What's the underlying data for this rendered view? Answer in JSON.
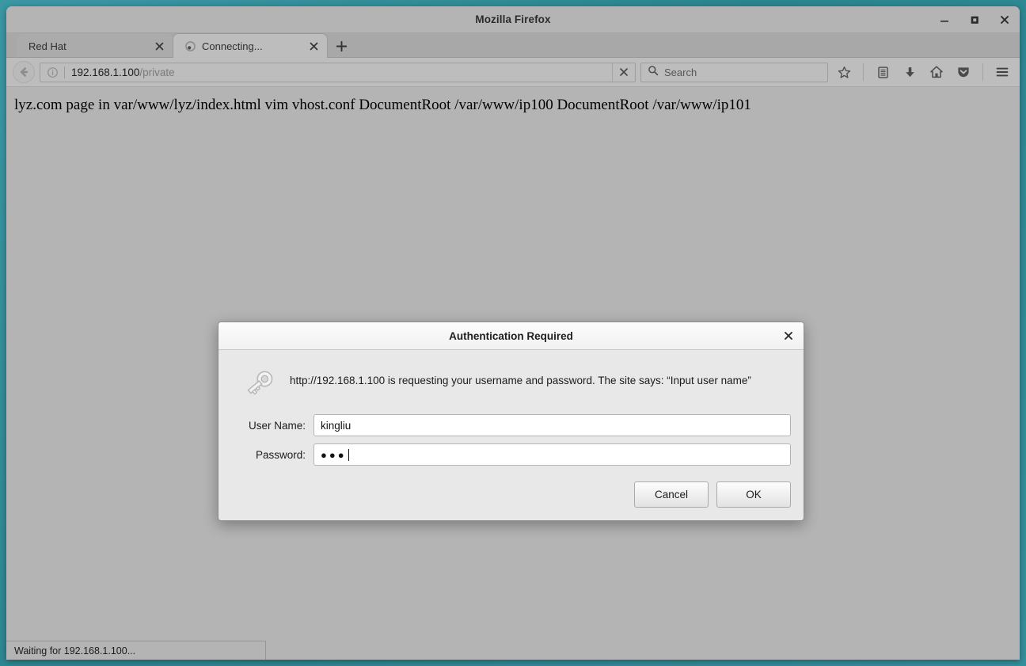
{
  "window": {
    "title": "Mozilla Firefox",
    "controls": [
      {
        "name": "minimize-button",
        "glyph": "minimize-icon"
      },
      {
        "name": "maximize-button",
        "glyph": "maximize-icon"
      },
      {
        "name": "close-button",
        "glyph": "close-icon"
      }
    ]
  },
  "tabs": [
    {
      "label": "Red Hat",
      "active": false,
      "loading": false
    },
    {
      "label": "Connecting...",
      "active": true,
      "loading": true
    }
  ],
  "newtab_label": "+",
  "toolbar": {
    "back_icon": "back-arrow-icon",
    "identity_icon": "info-icon",
    "url_host": "192.168.1.100",
    "url_path": "/private",
    "stop_icon": "stop-icon",
    "search": {
      "icon": "search-icon",
      "placeholder": "Search",
      "value": ""
    },
    "buttons": [
      {
        "name": "bookmark-star-button",
        "icon": "star-icon"
      },
      {
        "name": "library-button",
        "icon": "library-icon"
      },
      {
        "name": "downloads-button",
        "icon": "download-icon"
      },
      {
        "name": "home-button",
        "icon": "home-icon"
      },
      {
        "name": "pocket-button",
        "icon": "pocket-shield-icon"
      },
      {
        "name": "menu-button",
        "icon": "hamburger-menu-icon"
      }
    ]
  },
  "page": {
    "text": "lyz.com page in var/www/lyz/index.html vim vhost.conf DocumentRoot /var/www/ip100 DocumentRoot /var/www/ip101"
  },
  "status": {
    "text": "Waiting for 192.168.1.100..."
  },
  "dialog": {
    "title": "Authentication Required",
    "close_icon": "close-icon",
    "key_icon": "key-icon",
    "message": "http://192.168.1.100 is requesting your username and password. The site says: “Input user name”",
    "username": {
      "label": "User Name:",
      "value": "kingliu",
      "placeholder": ""
    },
    "password": {
      "label": "Password:",
      "value": "●●●",
      "placeholder": ""
    },
    "cancel_label": "Cancel",
    "ok_label": "OK"
  },
  "colors": {
    "desktop": "#2e8a96",
    "chrome": "#b4b4b4",
    "dialog_bg": "#e8e8e8",
    "page_bg": "#b4b4b4"
  }
}
